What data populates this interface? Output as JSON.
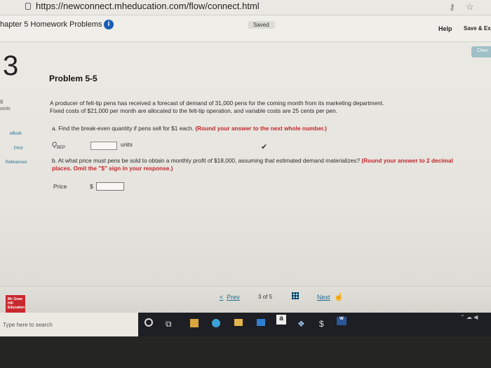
{
  "browser": {
    "url": "https://newconnect.mheducation.com/flow/connect.html"
  },
  "header": {
    "title": "hapter 5 Homework Problems",
    "saved": "Saved",
    "help": "Help",
    "save_exit": "Save & Ex",
    "check": "Chec"
  },
  "question": {
    "number": "3",
    "score": "6",
    "score_label": "oints"
  },
  "sidebar": {
    "ebook": "eBook",
    "print": "Print",
    "references": "References"
  },
  "problem": {
    "title": "Problem 5-5",
    "stem_line1": "A producer of felt-tip pens has received a forecast of demand of 31,000 pens for the coming month from its marketing department.",
    "stem_line2": "Fixed costs of $21,000 per month are allocated to the felt-tip operation, and variable costs are 25 cents per pen.",
    "part_a_text": "a. Find the break-even quantity if pens sell for $1 each. ",
    "part_a_instruction": "(Round your answer to the next whole number.)",
    "qbep_label": "Q",
    "qbep_sub": "BEP",
    "qbep_value": "",
    "units": "units",
    "part_b_text": "b. At what price must pens be sold to obtain a monthly profit of $18,000, assuming that estimated demand materializes? ",
    "part_b_instruction": "(Round your answer to 2 decimal places. Omit the \"$\" sign in your response.)",
    "price_label": "Price",
    "dollar": "$",
    "price_value": ""
  },
  "footer": {
    "logo": "Mc Graw Hill Education",
    "prev": "Prev",
    "page_current": "3",
    "page_of": "of",
    "page_total": "5",
    "next": "Next"
  },
  "taskbar": {
    "search_placeholder": "Type here to search",
    "amazon": "a",
    "word": "W"
  },
  "icons": [
    "lock-icon",
    "key-icon",
    "star-icon",
    "info-icon",
    "check-icon",
    "grid-icon",
    "cursor-icon",
    "cortana-icon",
    "taskview-icon",
    "store-icon",
    "edge-icon",
    "folder-icon",
    "mail-icon",
    "amazon-icon",
    "dropbox-icon",
    "money-icon",
    "word-icon"
  ],
  "colors": {
    "accent": "#1a6f94",
    "instruction_red": "#c0272d",
    "info_blue": "#1a5fb4",
    "brand_red": "#c8282e"
  }
}
